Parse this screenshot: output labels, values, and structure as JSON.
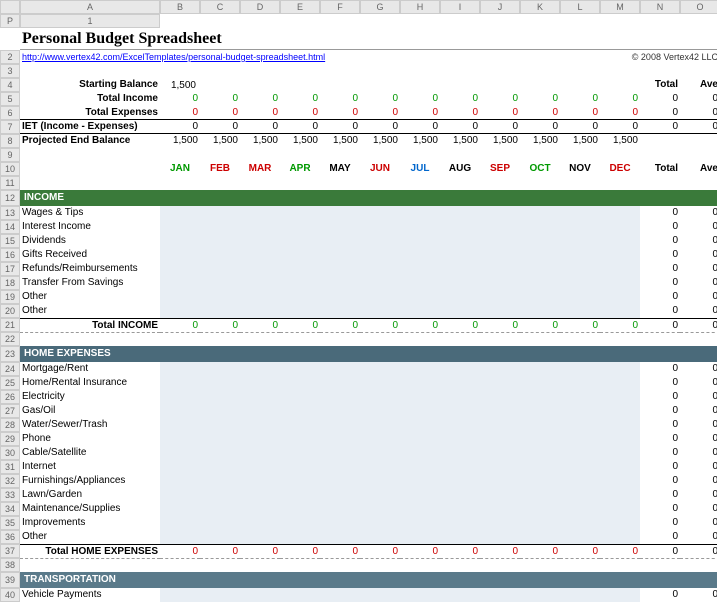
{
  "title": "Personal Budget Spreadsheet",
  "link": "http://www.vertex42.com/ExcelTemplates/personal-budget-spreadsheet.html",
  "copyright": "© 2008 Vertex42 LLC",
  "cols": [
    "A",
    "B",
    "C",
    "D",
    "E",
    "F",
    "G",
    "H",
    "I",
    "J",
    "K",
    "L",
    "M",
    "N",
    "O",
    "P"
  ],
  "labels": {
    "startBal": "Starting Balance",
    "startBalVal": "1,500",
    "totIncome": "Total Income",
    "totExp": "Total Expenses",
    "net": "IET (Income - Expenses)",
    "projEnd": "Projected End Balance",
    "total": "Total",
    "ave": "Ave"
  },
  "months": [
    {
      "t": "JAN",
      "c": "green"
    },
    {
      "t": "FEB",
      "c": "red"
    },
    {
      "t": "MAR",
      "c": "red"
    },
    {
      "t": "APR",
      "c": "green"
    },
    {
      "t": "MAY",
      "c": ""
    },
    {
      "t": "JUN",
      "c": "red"
    },
    {
      "t": "JUL",
      "c": "blue"
    },
    {
      "t": "AUG",
      "c": ""
    },
    {
      "t": "SEP",
      "c": "red"
    },
    {
      "t": "OCT",
      "c": "green"
    },
    {
      "t": "NOV",
      "c": ""
    },
    {
      "t": "DEC",
      "c": "red"
    }
  ],
  "zeros": [
    "0",
    "0",
    "0",
    "0",
    "0",
    "0",
    "0",
    "0",
    "0",
    "0",
    "0",
    "0"
  ],
  "proj": [
    "1,500",
    "1,500",
    "1,500",
    "1,500",
    "1,500",
    "1,500",
    "1,500",
    "1,500",
    "1,500",
    "1,500",
    "1,500",
    "1,500"
  ],
  "sections": [
    {
      "name": "INCOME",
      "cls": "",
      "items": [
        "Wages & Tips",
        "Interest Income",
        "Dividends",
        "Gifts Received",
        "Refunds/Reimbursements",
        "Transfer From Savings",
        "Other",
        "Other"
      ],
      "total": "Total INCOME"
    },
    {
      "name": "HOME EXPENSES",
      "cls": "home",
      "items": [
        "Mortgage/Rent",
        "Home/Rental Insurance",
        "Electricity",
        "Gas/Oil",
        "Water/Sewer/Trash",
        "Phone",
        "Cable/Satellite",
        "Internet",
        "Furnishings/Appliances",
        "Lawn/Garden",
        "Maintenance/Supplies",
        "Improvements",
        "Other"
      ],
      "total": "Total HOME EXPENSES"
    },
    {
      "name": "TRANSPORTATION",
      "cls": "trans",
      "items": [
        "Vehicle Payments"
      ],
      "total": null
    }
  ]
}
